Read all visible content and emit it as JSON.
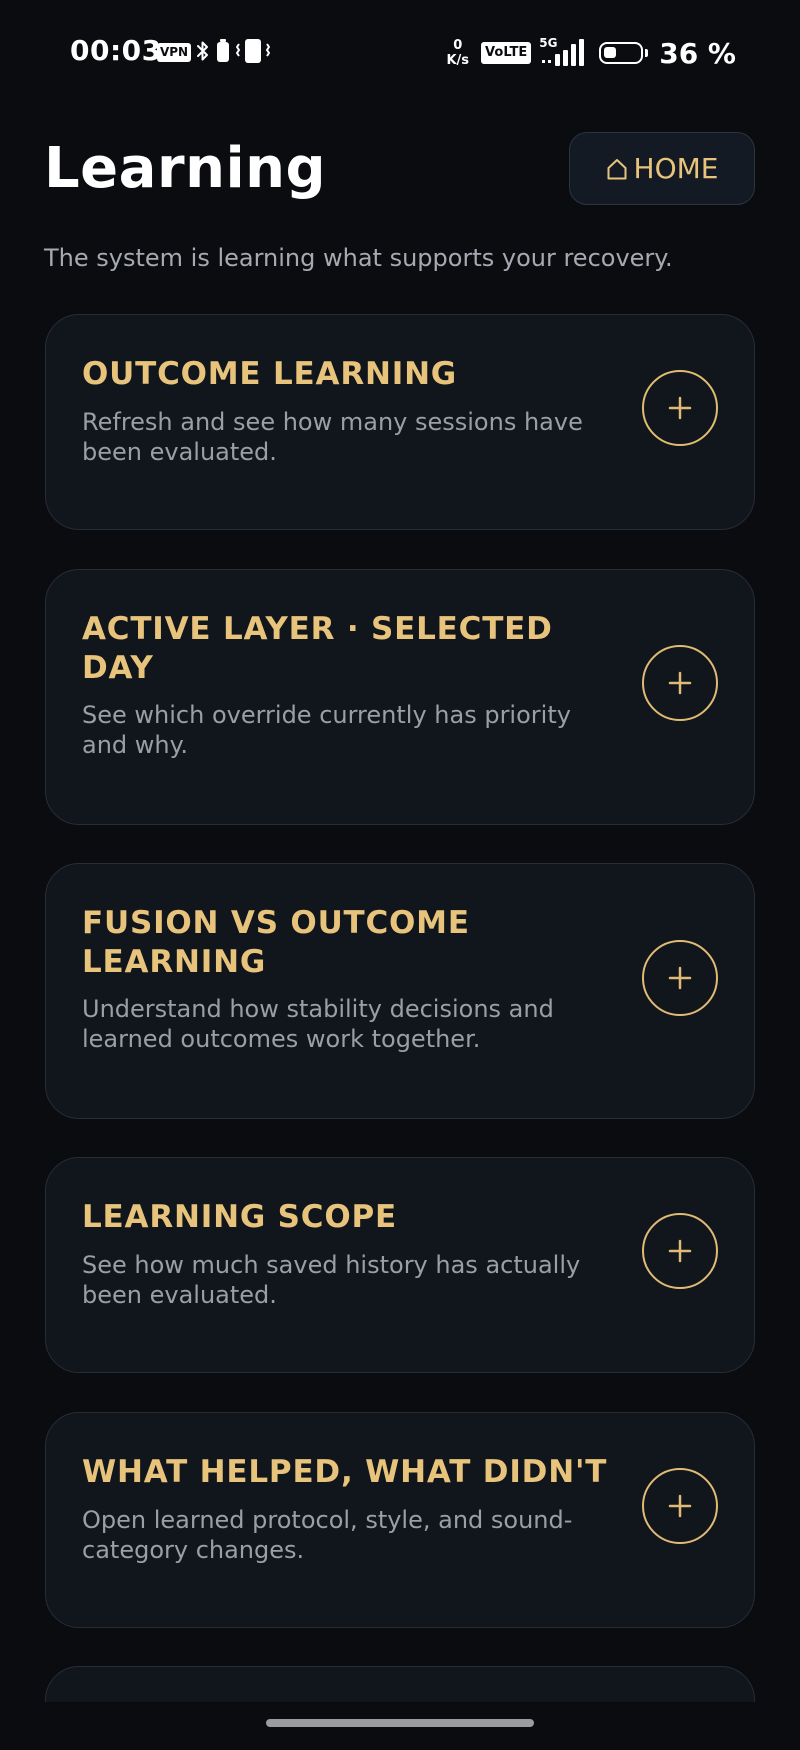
{
  "status_bar": {
    "time": "00:03",
    "vpn_label": "VPN",
    "speed_value": "0",
    "speed_unit": "K/s",
    "volte_label": "VoLTE",
    "network_label": "5G",
    "battery_percent": "36 %",
    "battery_level": 0.36
  },
  "header": {
    "title": "Learning",
    "home_label": "HOME",
    "subtitle": "The system is learning what supports your recovery."
  },
  "cards": [
    {
      "title": "OUTCOME LEARNING",
      "description": "Refresh and see how many sessions have been evaluated."
    },
    {
      "title": "ACTIVE LAYER · SELECTED DAY",
      "description": "See which override currently has priority and why."
    },
    {
      "title": "FUSION VS OUTCOME LEARNING",
      "description": "Understand how stability decisions and learned outcomes work together."
    },
    {
      "title": "LEARNING SCOPE",
      "description": "See how much saved history has actually been evaluated."
    },
    {
      "title": "WHAT HELPED, WHAT DIDN'T",
      "description": "Open learned protocol, style, and sound-category changes."
    }
  ],
  "colors": {
    "background": "#0a0c10",
    "card_background": "#11151c",
    "accent_gold": "#e7c37c",
    "muted_text": "#9a9ea6"
  }
}
